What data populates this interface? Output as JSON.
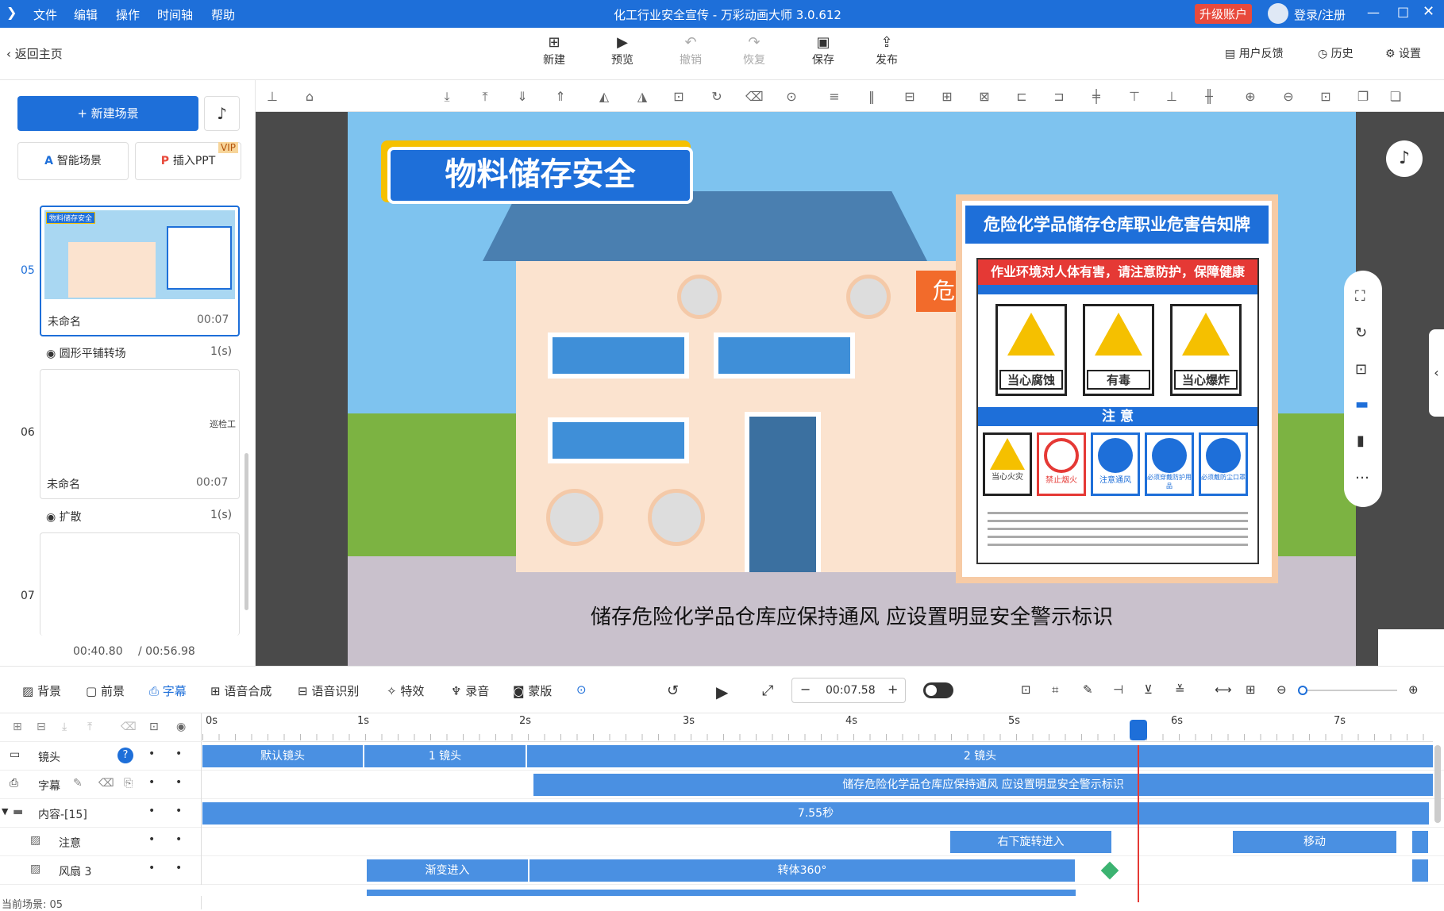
{
  "window": {
    "title": "化工行业安全宣传 - 万彩动画大师 3.0.612",
    "upgrade": "升级账户",
    "login": "登录/注册",
    "menu": [
      "文件",
      "编辑",
      "操作",
      "时间轴",
      "帮助"
    ]
  },
  "toolbar": {
    "back": "返回主页",
    "new": "新建",
    "preview": "预览",
    "undo": "撤销",
    "redo": "恢复",
    "save": "保存",
    "publish": "发布",
    "feedback": "用户反馈",
    "history": "历史",
    "settings": "设置"
  },
  "left": {
    "new_scene": "新建场景",
    "smart_scene": "智能场景",
    "insert_ppt": "插入PPT",
    "vip": "VIP",
    "scenes": [
      {
        "num": "05",
        "name": "未命名",
        "time": "00:07",
        "thumb_title": "物料储存安全"
      },
      {
        "num": "06",
        "name": "未命名",
        "time": "00:07",
        "thumb_text": "巡检工"
      },
      {
        "num": "07"
      }
    ],
    "transitions": [
      {
        "name": "圆形平铺转场",
        "dur": "1(s)"
      },
      {
        "name": "扩散",
        "dur": "1(s)"
      }
    ],
    "time_current": "00:40.80",
    "time_total": "/ 00:56.98"
  },
  "stage": {
    "banner": "物料储存安全",
    "subtitle": "储存危险化学品仓库应保持通风 应设置明显安全警示标识",
    "building_sign": "危",
    "board": {
      "title": "危险化学品储存仓库职业危害告知牌",
      "warning": "作业环境对人体有害，请注意防护，保障健康",
      "signs_top": [
        "当心腐蚀",
        "有毒",
        "当心爆炸"
      ],
      "notice": "注        意",
      "signs_bottom": [
        "当心火灾",
        "禁止烟火",
        "注意通风",
        "必须穿戴防护用品",
        "必须戴防尘口罩"
      ]
    }
  },
  "controls": {
    "bg": "背景",
    "fg": "前景",
    "subtitle": "字幕",
    "tts": "语音合成",
    "asr": "语音识别",
    "fx": "特效",
    "record": "录音",
    "mask": "蒙版",
    "time": "00:07.58"
  },
  "timeline": {
    "ticks": [
      "0s",
      "1s",
      "2s",
      "3s",
      "4s",
      "5s",
      "6s",
      "7s"
    ],
    "tracks": [
      {
        "label": "镜头",
        "clips": [
          {
            "text": "默认镜头"
          },
          {
            "text": "1 镜头"
          },
          {
            "text": "2 镜头"
          }
        ]
      },
      {
        "label": "字幕",
        "clips": [
          {
            "text": "储存危险化学品仓库应保持通风 应设置明显安全警示标识"
          }
        ]
      },
      {
        "label": "内容-[15]",
        "clips": [
          {
            "text": "7.55秒"
          }
        ]
      },
      {
        "label": "注意",
        "clips": [
          {
            "text": "右下旋转进入"
          },
          {
            "text": "移动"
          }
        ]
      },
      {
        "label": "风扇 3",
        "clips": [
          {
            "text": "渐变进入"
          },
          {
            "text": "转体360°"
          }
        ]
      }
    ],
    "current_scene": "当前场景: 05"
  }
}
